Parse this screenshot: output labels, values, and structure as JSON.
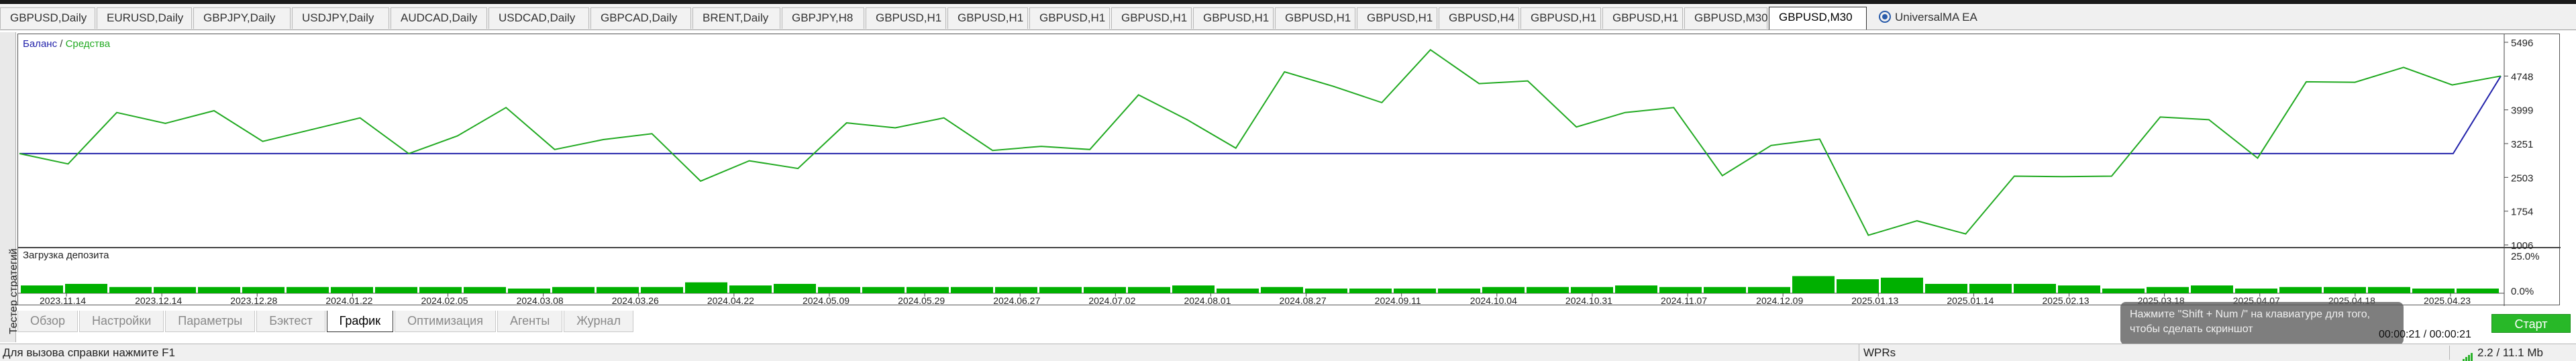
{
  "chart_tabs": [
    {
      "label": "GBPUSD,Daily"
    },
    {
      "label": "EURUSD,Daily"
    },
    {
      "label": "GBPJPY,Daily"
    },
    {
      "label": "USDJPY,Daily"
    },
    {
      "label": "AUDCAD,Daily"
    },
    {
      "label": "USDCAD,Daily"
    },
    {
      "label": "GBPCAD,Daily"
    },
    {
      "label": "BRENT,Daily"
    },
    {
      "label": "GBPJPY,H8"
    },
    {
      "label": "GBPUSD,H1"
    },
    {
      "label": "GBPUSD,H1"
    },
    {
      "label": "GBPUSD,H1"
    },
    {
      "label": "GBPUSD,H1"
    },
    {
      "label": "GBPUSD,H1"
    },
    {
      "label": "GBPUSD,H1"
    },
    {
      "label": "GBPUSD,H1"
    },
    {
      "label": "GBPUSD,H4"
    },
    {
      "label": "GBPUSD,H1"
    },
    {
      "label": "GBPUSD,H1"
    },
    {
      "label": "GBPUSD,M30"
    },
    {
      "label": "GBPUSD,M30"
    }
  ],
  "active_chart_tab": "GBPUSD,M30",
  "ea_tab": {
    "label": "UniversalMA EA",
    "icon": "expert-advisor-icon"
  },
  "side_title": "Тестер стратегий",
  "legend": {
    "balance": "Баланс",
    "separator": "/",
    "equity": "Средства",
    "balance_color": "#2222aa",
    "equity_color": "#22aa22"
  },
  "deposit_label": "Загрузка депозита",
  "chart_data": {
    "type": "line",
    "series": [
      {
        "name": "Баланс",
        "color": "#2222aa",
        "values": [
          3030,
          3030,
          3030,
          3030,
          3030,
          3030,
          3030,
          3030,
          3030,
          3030,
          3030,
          3030,
          3030,
          3030,
          3030,
          3030,
          3030,
          3030,
          3030,
          3030,
          3030,
          3030,
          3030,
          3030,
          3030,
          3030,
          3030,
          3030,
          3030,
          3030,
          3030,
          3030,
          3030,
          3030,
          3030,
          3030,
          3030,
          3030,
          3030,
          3030,
          3030,
          3030,
          3030,
          3030,
          3030,
          3030,
          3030,
          3030,
          3030,
          3030,
          3030,
          3030,
          4748
        ]
      },
      {
        "name": "Средства",
        "color": "#22aa22",
        "values": [
          3030,
          2800,
          3940,
          3700,
          3980,
          3300,
          3560,
          3820,
          3030,
          3420,
          4050,
          3120,
          3340,
          3470,
          2420,
          2870,
          2700,
          3710,
          3600,
          3820,
          3100,
          3190,
          3120,
          4330,
          3780,
          3150,
          4840,
          4520,
          4160,
          5330,
          4580,
          4640,
          3620,
          3940,
          4050,
          2540,
          3210,
          3350,
          1220,
          1540,
          1250,
          2530,
          2520,
          2530,
          3840,
          3780,
          2930,
          4620,
          4610,
          4940,
          4550,
          4748
        ]
      }
    ],
    "points_note": "",
    "ylim": [
      1006,
      5496
    ],
    "y_ticks": [
      "5496",
      "4748",
      "3999",
      "3251",
      "2503",
      "1754",
      "1006"
    ],
    "x_ticks": [
      "2023.11.14",
      "2023.12.14",
      "2023.12.28",
      "2024.01.22",
      "2024.02.05",
      "2024.03.08",
      "2024.03.26",
      "2024.04.22",
      "2024.05.09",
      "2024.05.29",
      "2024.06.27",
      "2024.07.02",
      "2024.08.01",
      "2024.08.27",
      "2024.09.11",
      "2024.10.04",
      "2024.10.31",
      "2024.11.07",
      "2024.12.09",
      "2025.01.13",
      "2025.01.14",
      "2025.02.13",
      "2025.03.18",
      "2025.04.07",
      "2025.04.18",
      "2025.04.23"
    ],
    "deposit_load": {
      "color": "#00b000",
      "y_ticks": [
        "25.0%",
        "0.0%"
      ],
      "ylim": [
        0,
        25
      ],
      "values": [
        5,
        6,
        4,
        4,
        4,
        4,
        4,
        4,
        4,
        4,
        4,
        3,
        4,
        4,
        4,
        7,
        5,
        6,
        4,
        4,
        4,
        4,
        4,
        4,
        4,
        4,
        5,
        3,
        4,
        3,
        3,
        3,
        3,
        4,
        4,
        4,
        5,
        4,
        4,
        4,
        11,
        9,
        10,
        6,
        6,
        6,
        5,
        3,
        4,
        5,
        3,
        4,
        4,
        4,
        3,
        3
      ]
    }
  },
  "bottom_tabs": [
    {
      "label": "Обзор"
    },
    {
      "label": "Настройки"
    },
    {
      "label": "Параметры"
    },
    {
      "label": "Бэктест"
    },
    {
      "label": "График"
    },
    {
      "label": "Оптимизация"
    },
    {
      "label": "Агенты"
    },
    {
      "label": "Журнал"
    }
  ],
  "active_bottom_tab": "График",
  "start_button": {
    "label": "Старт",
    "color": "#28b828"
  },
  "tooltip": {
    "line1": "Нажмите \"Shift + Num /\" на клавиатуре для того,",
    "line2": "чтобы сделать скриншот"
  },
  "timer": "00:00:21 / 00:00:21",
  "status": {
    "help": "Для вызова справки нажмите F1",
    "indicator": "WPRs",
    "net": "2.2 / 11.1 Mb"
  }
}
